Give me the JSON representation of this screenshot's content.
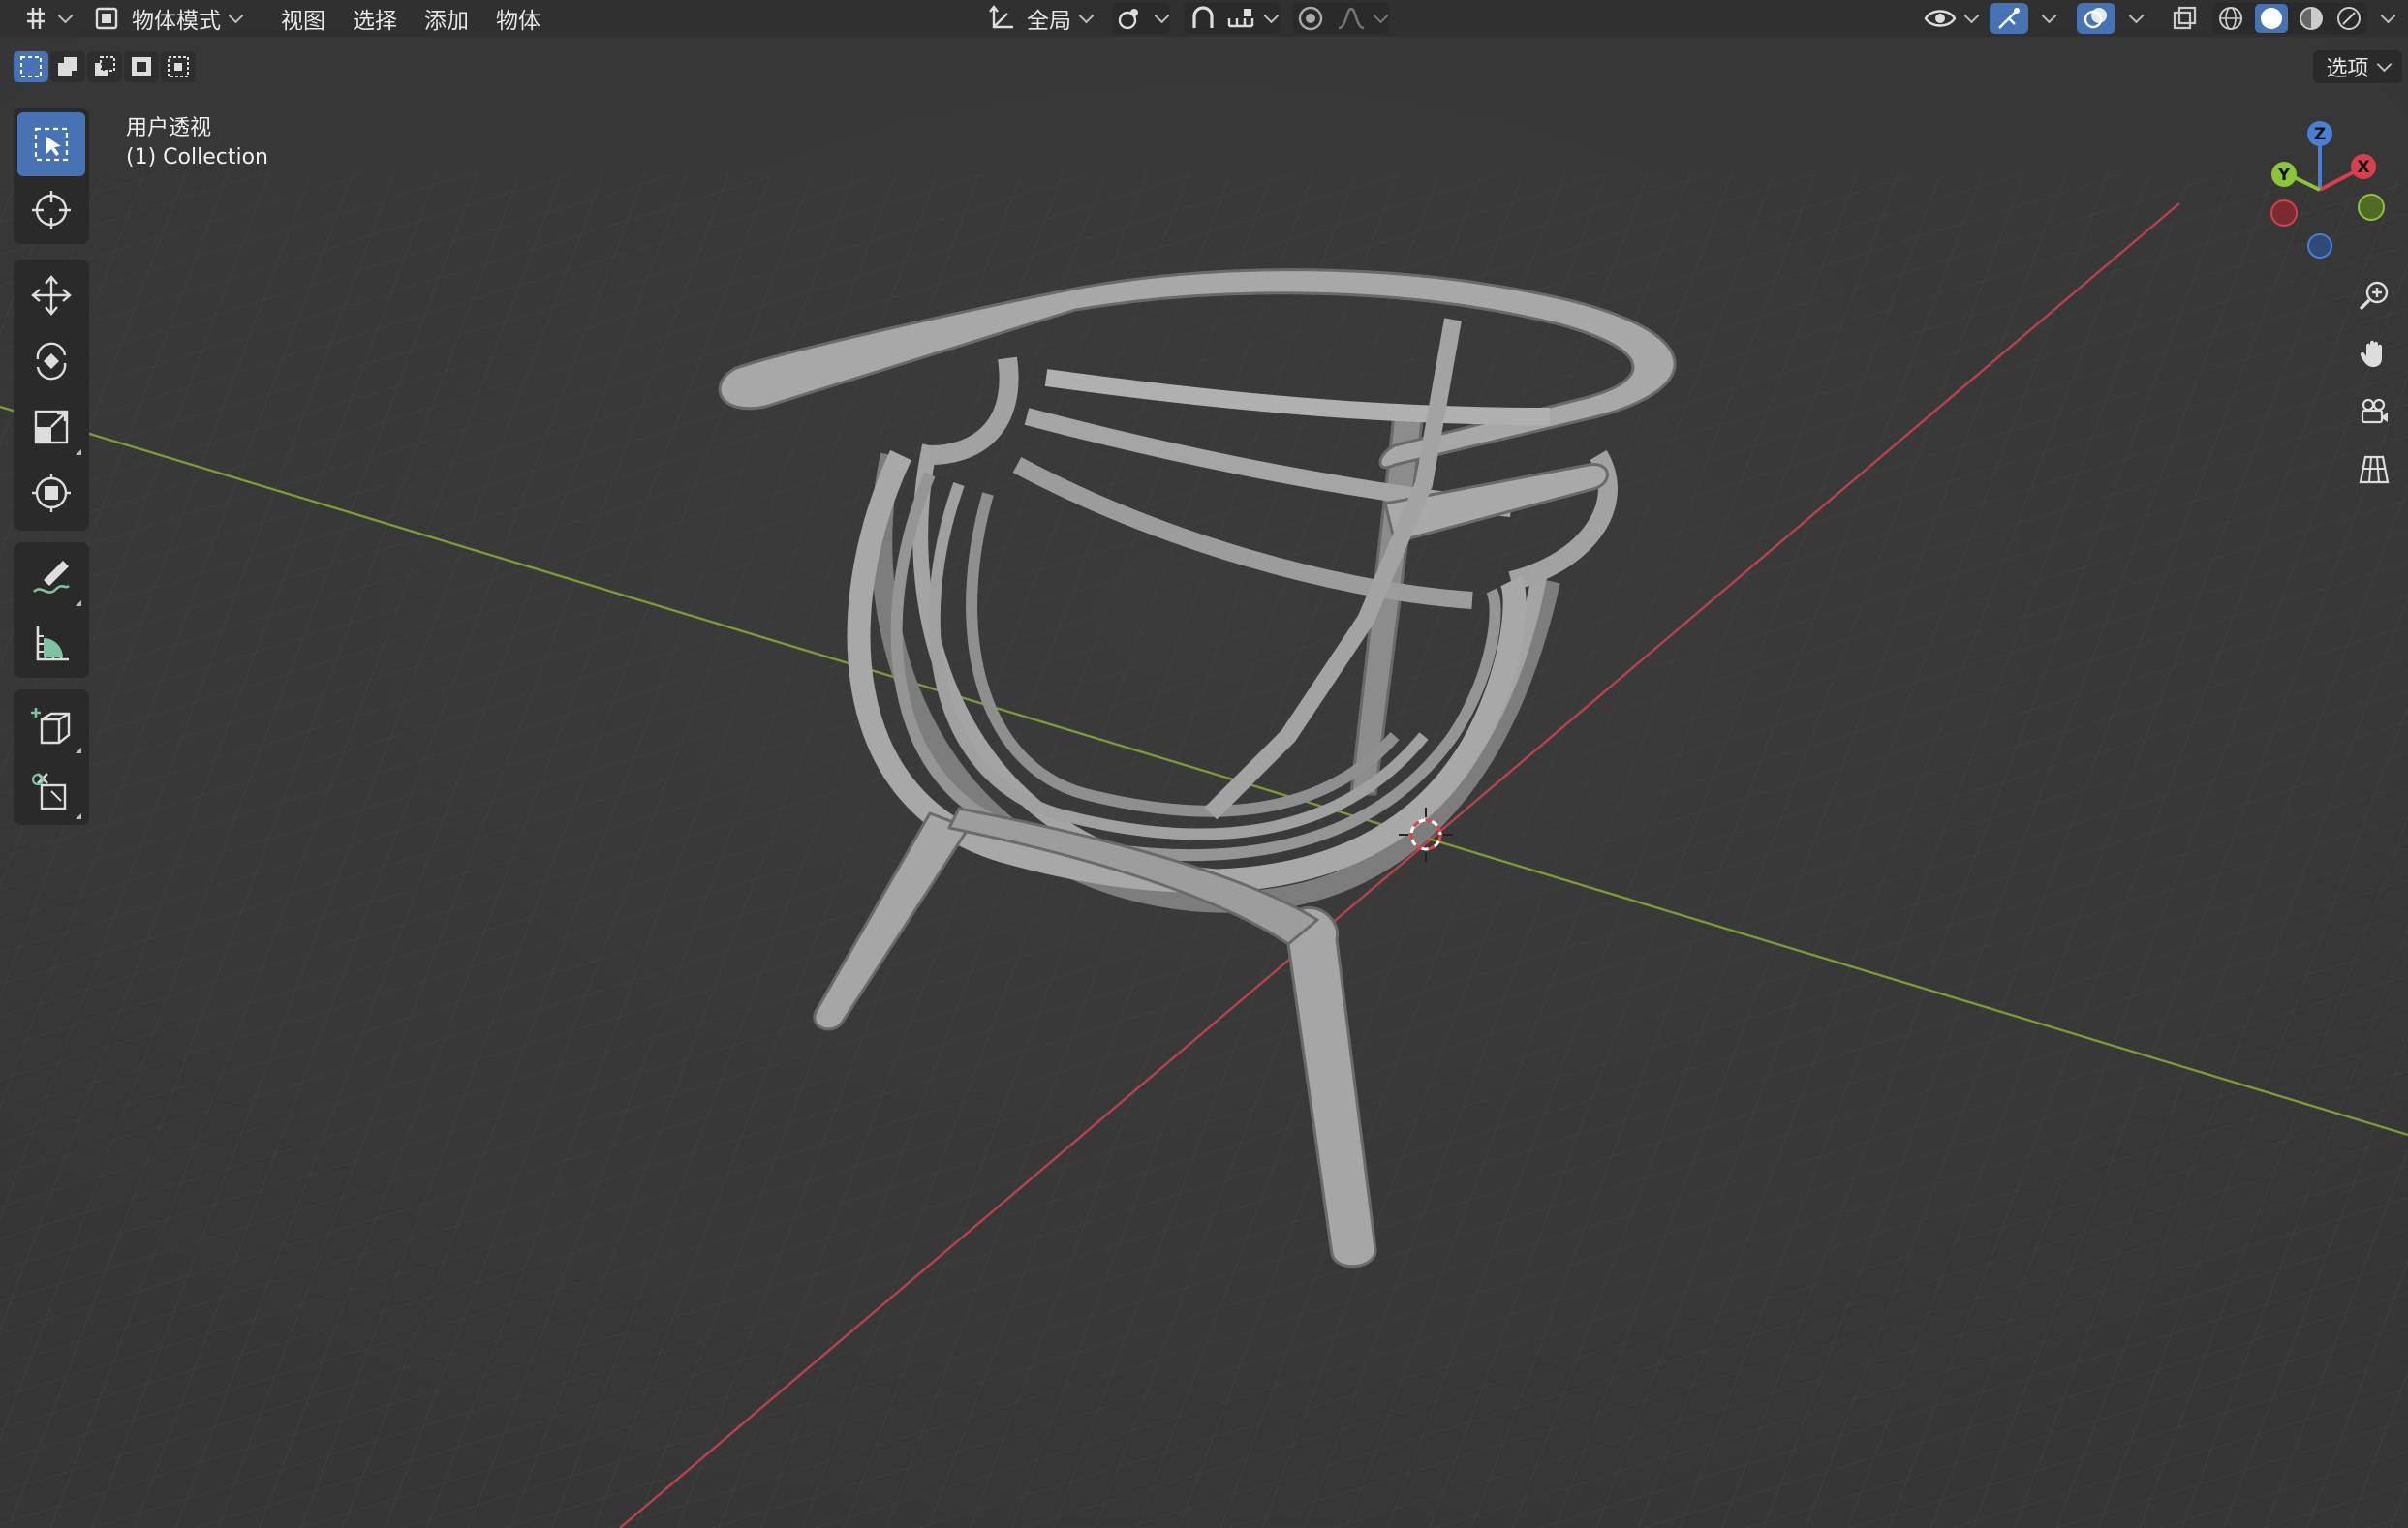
{
  "header": {
    "editor_type_icon": "editor-type-icon",
    "mode_label": "物体模式",
    "menus": [
      "视图",
      "选择",
      "添加",
      "物体"
    ],
    "transform_orientation": "全局",
    "options_label": "选项"
  },
  "viewport": {
    "view_name": "用户透视",
    "collection": "(1) Collection",
    "gizmo_axes": [
      "X",
      "Y",
      "Z"
    ]
  },
  "toolbar": {
    "tools": [
      "select-box-icon",
      "cursor-icon",
      "move-icon",
      "rotate-icon",
      "scale-icon",
      "transform-icon",
      "annotate-icon",
      "measure-icon",
      "add-cube-icon",
      "add-object-icon"
    ]
  },
  "colors": {
    "accent": "#4772b3",
    "x_axis": "#d6404c",
    "y_axis": "#8cc43c",
    "z_axis": "#4a7fd2",
    "background": "#3a3a3a",
    "header": "#303030"
  }
}
